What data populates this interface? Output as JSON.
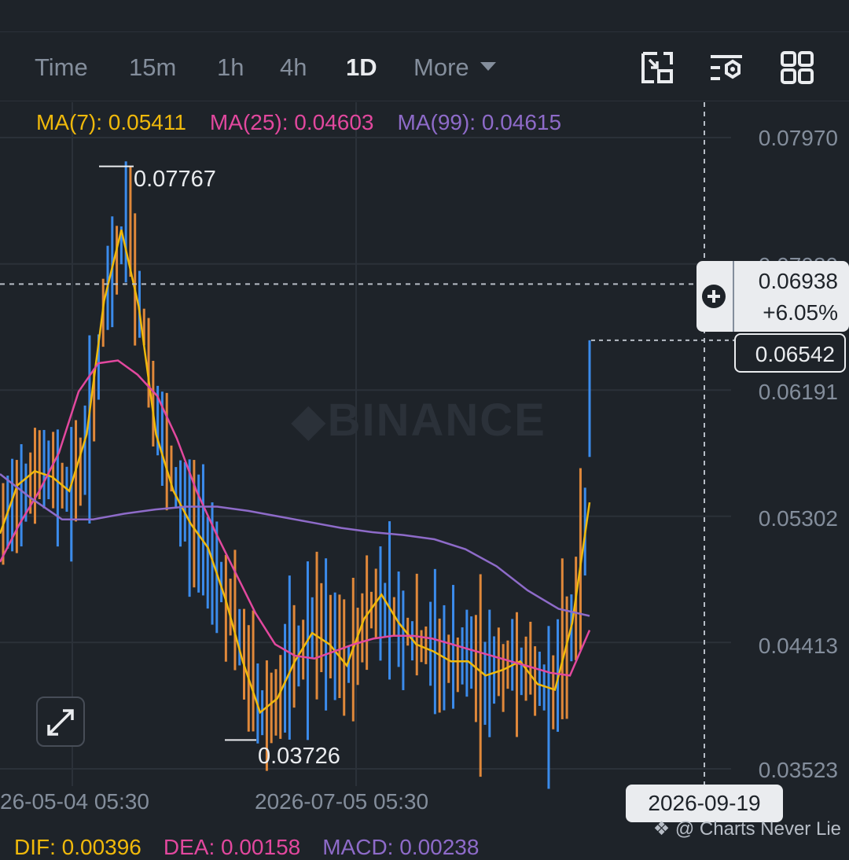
{
  "toolbar": {
    "timeframes": [
      "Time",
      "15m",
      "1h",
      "4h",
      "1D"
    ],
    "active": "1D",
    "more_label": "More"
  },
  "indicators": {
    "ma7": "MA(7): 0.05411",
    "ma25": "MA(25): 0.04603",
    "ma99": "MA(99): 0.04615"
  },
  "price_axis": [
    "0.07970",
    "0.07080",
    "0.06191",
    "0.05302",
    "0.04413",
    "0.03523"
  ],
  "current": {
    "price": "0.06938",
    "change": "+6.05%"
  },
  "last_price": "0.06542",
  "high_label": "0.07767",
  "low_label": "0.03726",
  "date_axis": [
    "26-05-04 05:30",
    "2026-07-05 05:30"
  ],
  "crosshair_date": "2026-09-19",
  "watermark": "BINANCE",
  "credit": "@ Charts Never Lie",
  "macd": {
    "dif": "DIF: 0.00396",
    "dea": "DEA: 0.00158",
    "macd": "MACD: 0.00238"
  },
  "colors": {
    "up": "#3b8beb",
    "down": "#e0883a",
    "ma7": "#f0b90b",
    "ma25": "#e2489e",
    "ma99": "#8e6bc9",
    "background": "#1e2329",
    "grid": "#2b3139",
    "text": "#848e9c"
  },
  "icons": [
    "crop-icon",
    "indicator-settings-icon",
    "grid-layout-icon",
    "expand-icon"
  ],
  "chart_data": {
    "type": "candlestick",
    "ylim": [
      0.03523,
      0.0797
    ],
    "high": 0.07767,
    "low": 0.03726,
    "last": 0.06542,
    "crosshair_price": 0.06938,
    "series": [
      {
        "name": "MA(7)",
        "values": [
          0.0518,
          0.0552,
          0.0562,
          0.0558,
          0.0548,
          0.0588,
          0.0682,
          0.0732,
          0.0678,
          0.0588,
          0.0548,
          0.0525,
          0.0508,
          0.0472,
          0.0428,
          0.0392,
          0.0402,
          0.0428,
          0.0448,
          0.044,
          0.0425,
          0.0458,
          0.0475,
          0.0455,
          0.044,
          0.0435,
          0.0428,
          0.0428,
          0.0418,
          0.0422,
          0.0428,
          0.0412,
          0.0408,
          0.0455,
          0.054
        ]
      },
      {
        "name": "MA(25)",
        "values": [
          0.0498,
          0.0525,
          0.0548,
          0.0575,
          0.0618,
          0.0638,
          0.064,
          0.063,
          0.0615,
          0.0585,
          0.0548,
          0.0518,
          0.049,
          0.0462,
          0.044,
          0.0432,
          0.043,
          0.0435,
          0.044,
          0.0444,
          0.0446,
          0.0446,
          0.0444,
          0.044,
          0.0436,
          0.0432,
          0.0428,
          0.0424,
          0.042,
          0.0418,
          0.045
        ]
      },
      {
        "name": "MA(99)",
        "values": [
          0.056,
          0.0543,
          0.0528,
          0.0528,
          0.0532,
          0.0535,
          0.0537,
          0.0537,
          0.0534,
          0.053,
          0.0526,
          0.0522,
          0.0519,
          0.0517,
          0.0514,
          0.0507,
          0.0495,
          0.0478,
          0.0465,
          0.046
        ]
      }
    ]
  }
}
